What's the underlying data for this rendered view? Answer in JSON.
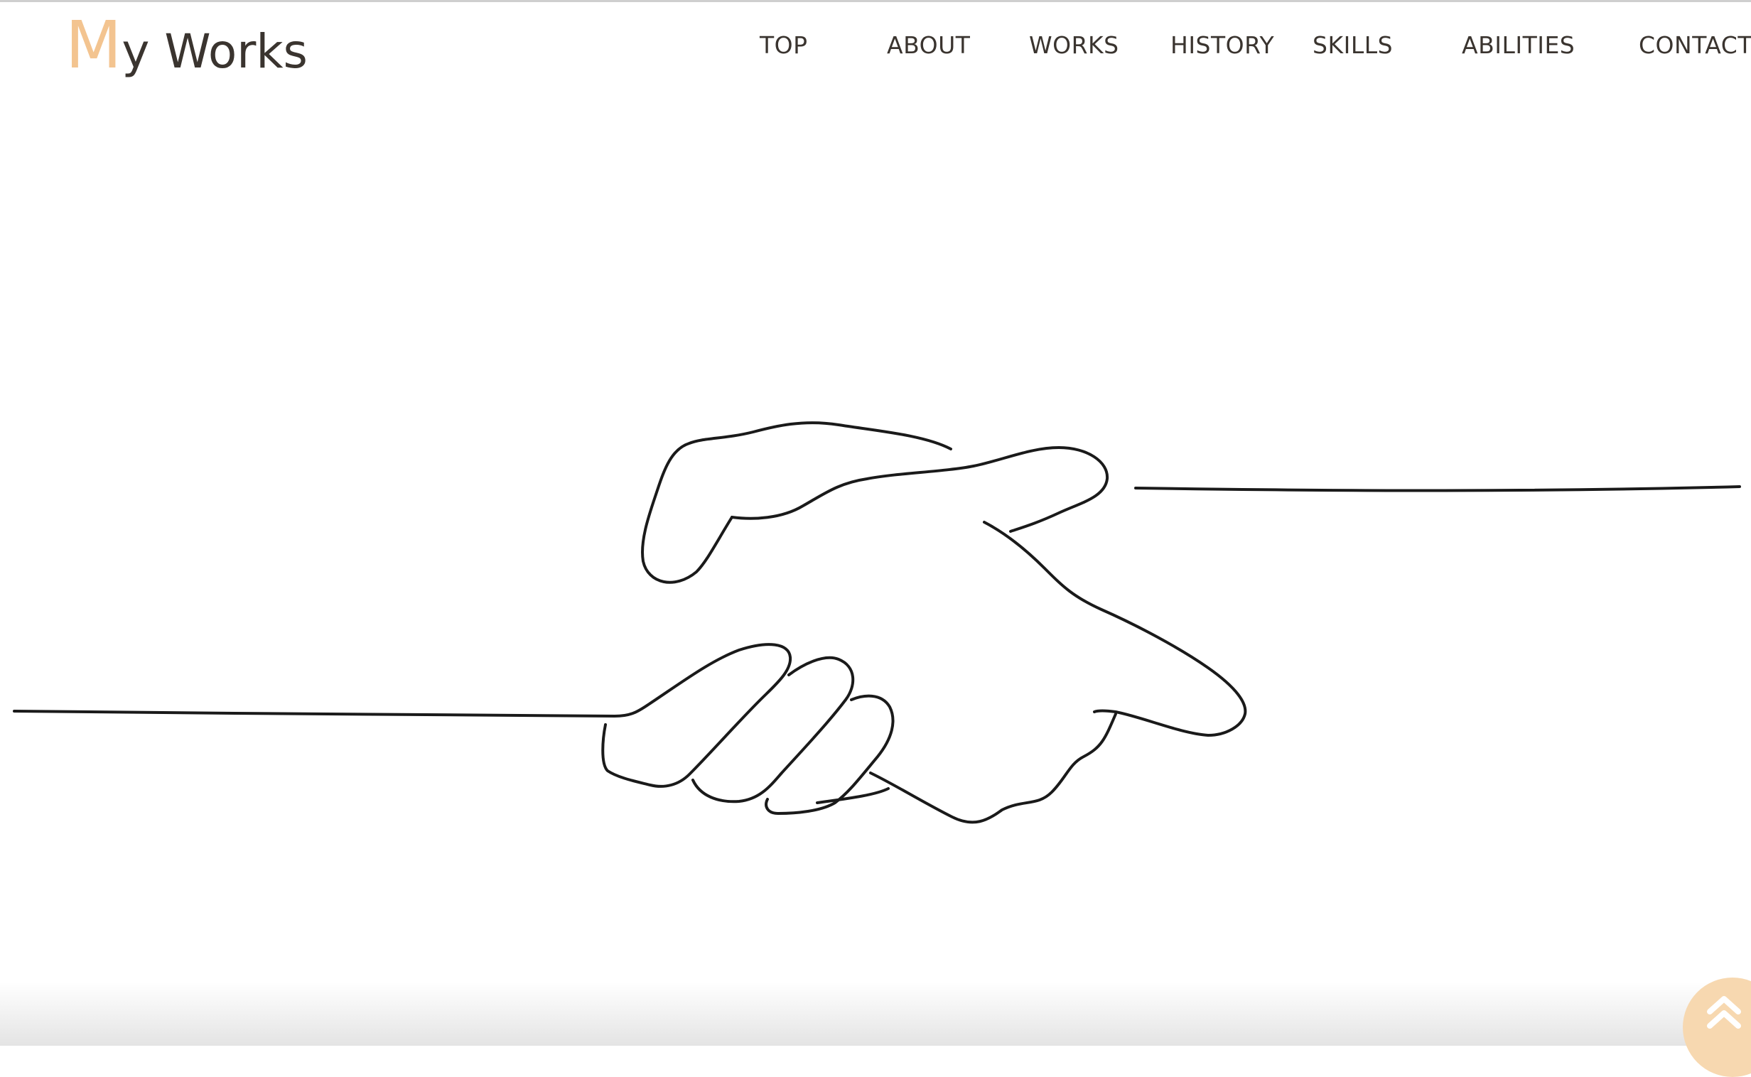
{
  "logo": {
    "first_letter": "M",
    "rest": "y Works",
    "accent_color": "#f3c490",
    "text_color": "#3a342f"
  },
  "nav": {
    "items": [
      "TOP",
      "ABOUT",
      "WORKS",
      "HISTORY",
      "SKILLS",
      "ABILITIES",
      "CONTACT"
    ]
  },
  "hero": {
    "illustration": "handshake-line-art"
  },
  "back_to_top": {
    "icon": "double-chevron-up-icon",
    "bg_color": "#f7d8b0",
    "icon_color": "#ffffff"
  }
}
